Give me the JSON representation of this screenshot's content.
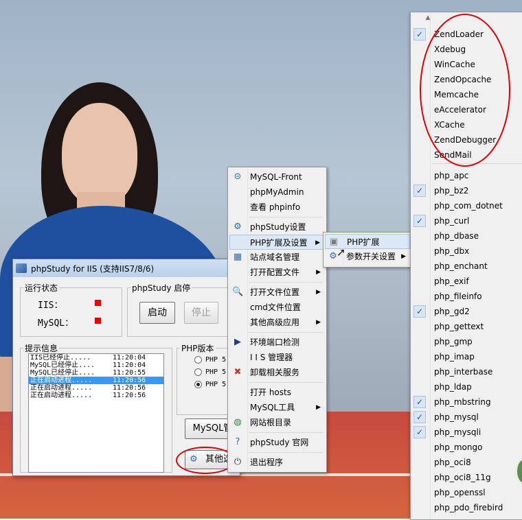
{
  "main_window": {
    "title": "phpStudy for IIS (支持IIS7/8/6)",
    "status_group": {
      "legend": "运行状态",
      "rows": [
        {
          "label": "IIS："
        },
        {
          "label": "MySQL："
        }
      ]
    },
    "control_group": {
      "legend": "phpStudy 启停",
      "start": "启动",
      "stop": "停止"
    },
    "log_group": {
      "legend": "提示信息",
      "rows": [
        {
          "msg": "IIS已经停止.....",
          "time": "11:20:04"
        },
        {
          "msg": "MySQL已经停止....",
          "time": "11:20:04"
        },
        {
          "msg": "MySQL已经停止....",
          "time": "11:20:55"
        },
        {
          "msg": "正在启动进程.....",
          "time": "11:20:56",
          "selected": true
        },
        {
          "msg": "正在启动进程.....",
          "time": "11:20:56"
        },
        {
          "msg": "正在启动进程.....",
          "time": "11:20:56"
        }
      ]
    },
    "php_group": {
      "legend": "PHP版本",
      "options": [
        {
          "label": "PHP 5.",
          "checked": false
        },
        {
          "label": "PHP 5.",
          "checked": false
        },
        {
          "label": "PHP 5.",
          "checked": true
        }
      ]
    },
    "mysql_button": "MySQL管",
    "other_button": "其他选"
  },
  "context_menu": {
    "items": [
      {
        "label": "MySQL-Front",
        "icon": "link-icon"
      },
      {
        "label": "phpMyAdmin",
        "icon": ""
      },
      {
        "label": "查看 phpinfo",
        "icon": ""
      },
      {
        "label": "phpStudy设置",
        "icon": "gear-icon"
      },
      {
        "label": "PHP扩展及设置",
        "icon": "",
        "submenu": true,
        "highlighted": true
      },
      {
        "label": "站点域名管理",
        "icon": "network-icon"
      },
      {
        "label": "打开配置文件",
        "icon": "",
        "submenu": true
      },
      {
        "label": "打开文件位置",
        "icon": "search-icon",
        "submenu": true
      },
      {
        "label": "cmd文件位置",
        "icon": ""
      },
      {
        "label": "其他高级应用",
        "icon": "",
        "submenu": true
      },
      {
        "label": "环境端口检测",
        "icon": "play-icon"
      },
      {
        "label": "I I S 管理器",
        "icon": ""
      },
      {
        "label": "卸载相关服务",
        "icon": "uninstall-icon"
      },
      {
        "label": "打开 hosts",
        "icon": ""
      },
      {
        "label": "MySQL工具",
        "icon": "",
        "submenu": true
      },
      {
        "label": "网站根目录",
        "icon": "globe-icon"
      },
      {
        "label": "phpStudy 官网",
        "icon": "help-icon"
      },
      {
        "label": "退出程序",
        "icon": "exit-icon"
      }
    ]
  },
  "php_submenu": {
    "items": [
      {
        "label": "PHP扩展",
        "icon": "extension-icon",
        "highlighted": true
      },
      {
        "label": "参数开关设置",
        "icon": "gear-icon",
        "submenu": true
      }
    ]
  },
  "extension_list": {
    "zend_items": [
      {
        "label": "ZendLoader",
        "checked": true
      },
      {
        "label": "Xdebug",
        "checked": false
      },
      {
        "label": "WinCache",
        "checked": false
      },
      {
        "label": "ZendOpcache",
        "checked": false
      },
      {
        "label": "Memcache",
        "checked": false
      },
      {
        "label": "eAccelerator",
        "checked": false
      },
      {
        "label": "XCache",
        "checked": false
      },
      {
        "label": "ZendDebugger",
        "checked": false
      },
      {
        "label": "SendMail",
        "checked": false
      }
    ],
    "php_items": [
      {
        "label": "php_apc",
        "checked": false
      },
      {
        "label": "php_bz2",
        "checked": true
      },
      {
        "label": "php_com_dotnet",
        "checked": false
      },
      {
        "label": "php_curl",
        "checked": true
      },
      {
        "label": "php_dbase",
        "checked": false
      },
      {
        "label": "php_dbx",
        "checked": false
      },
      {
        "label": "php_enchant",
        "checked": false
      },
      {
        "label": "php_exif",
        "checked": false
      },
      {
        "label": "php_fileinfo",
        "checked": false
      },
      {
        "label": "php_gd2",
        "checked": true
      },
      {
        "label": "php_gettext",
        "checked": false
      },
      {
        "label": "php_gmp",
        "checked": false
      },
      {
        "label": "php_imap",
        "checked": false
      },
      {
        "label": "php_interbase",
        "checked": false
      },
      {
        "label": "php_ldap",
        "checked": false
      },
      {
        "label": "php_mbstring",
        "checked": true
      },
      {
        "label": "php_mysql",
        "checked": true
      },
      {
        "label": "php_mysqli",
        "checked": true
      },
      {
        "label": "php_mongo",
        "checked": false
      },
      {
        "label": "php_oci8",
        "checked": false
      },
      {
        "label": "php_oci8_11g",
        "checked": false
      },
      {
        "label": "php_openssl",
        "checked": false
      },
      {
        "label": "php_pdo_firebird",
        "checked": false
      }
    ]
  },
  "colors": {
    "led_stopped": "#ee0000",
    "annotation": "#e00000",
    "selection": "#3399ff"
  }
}
